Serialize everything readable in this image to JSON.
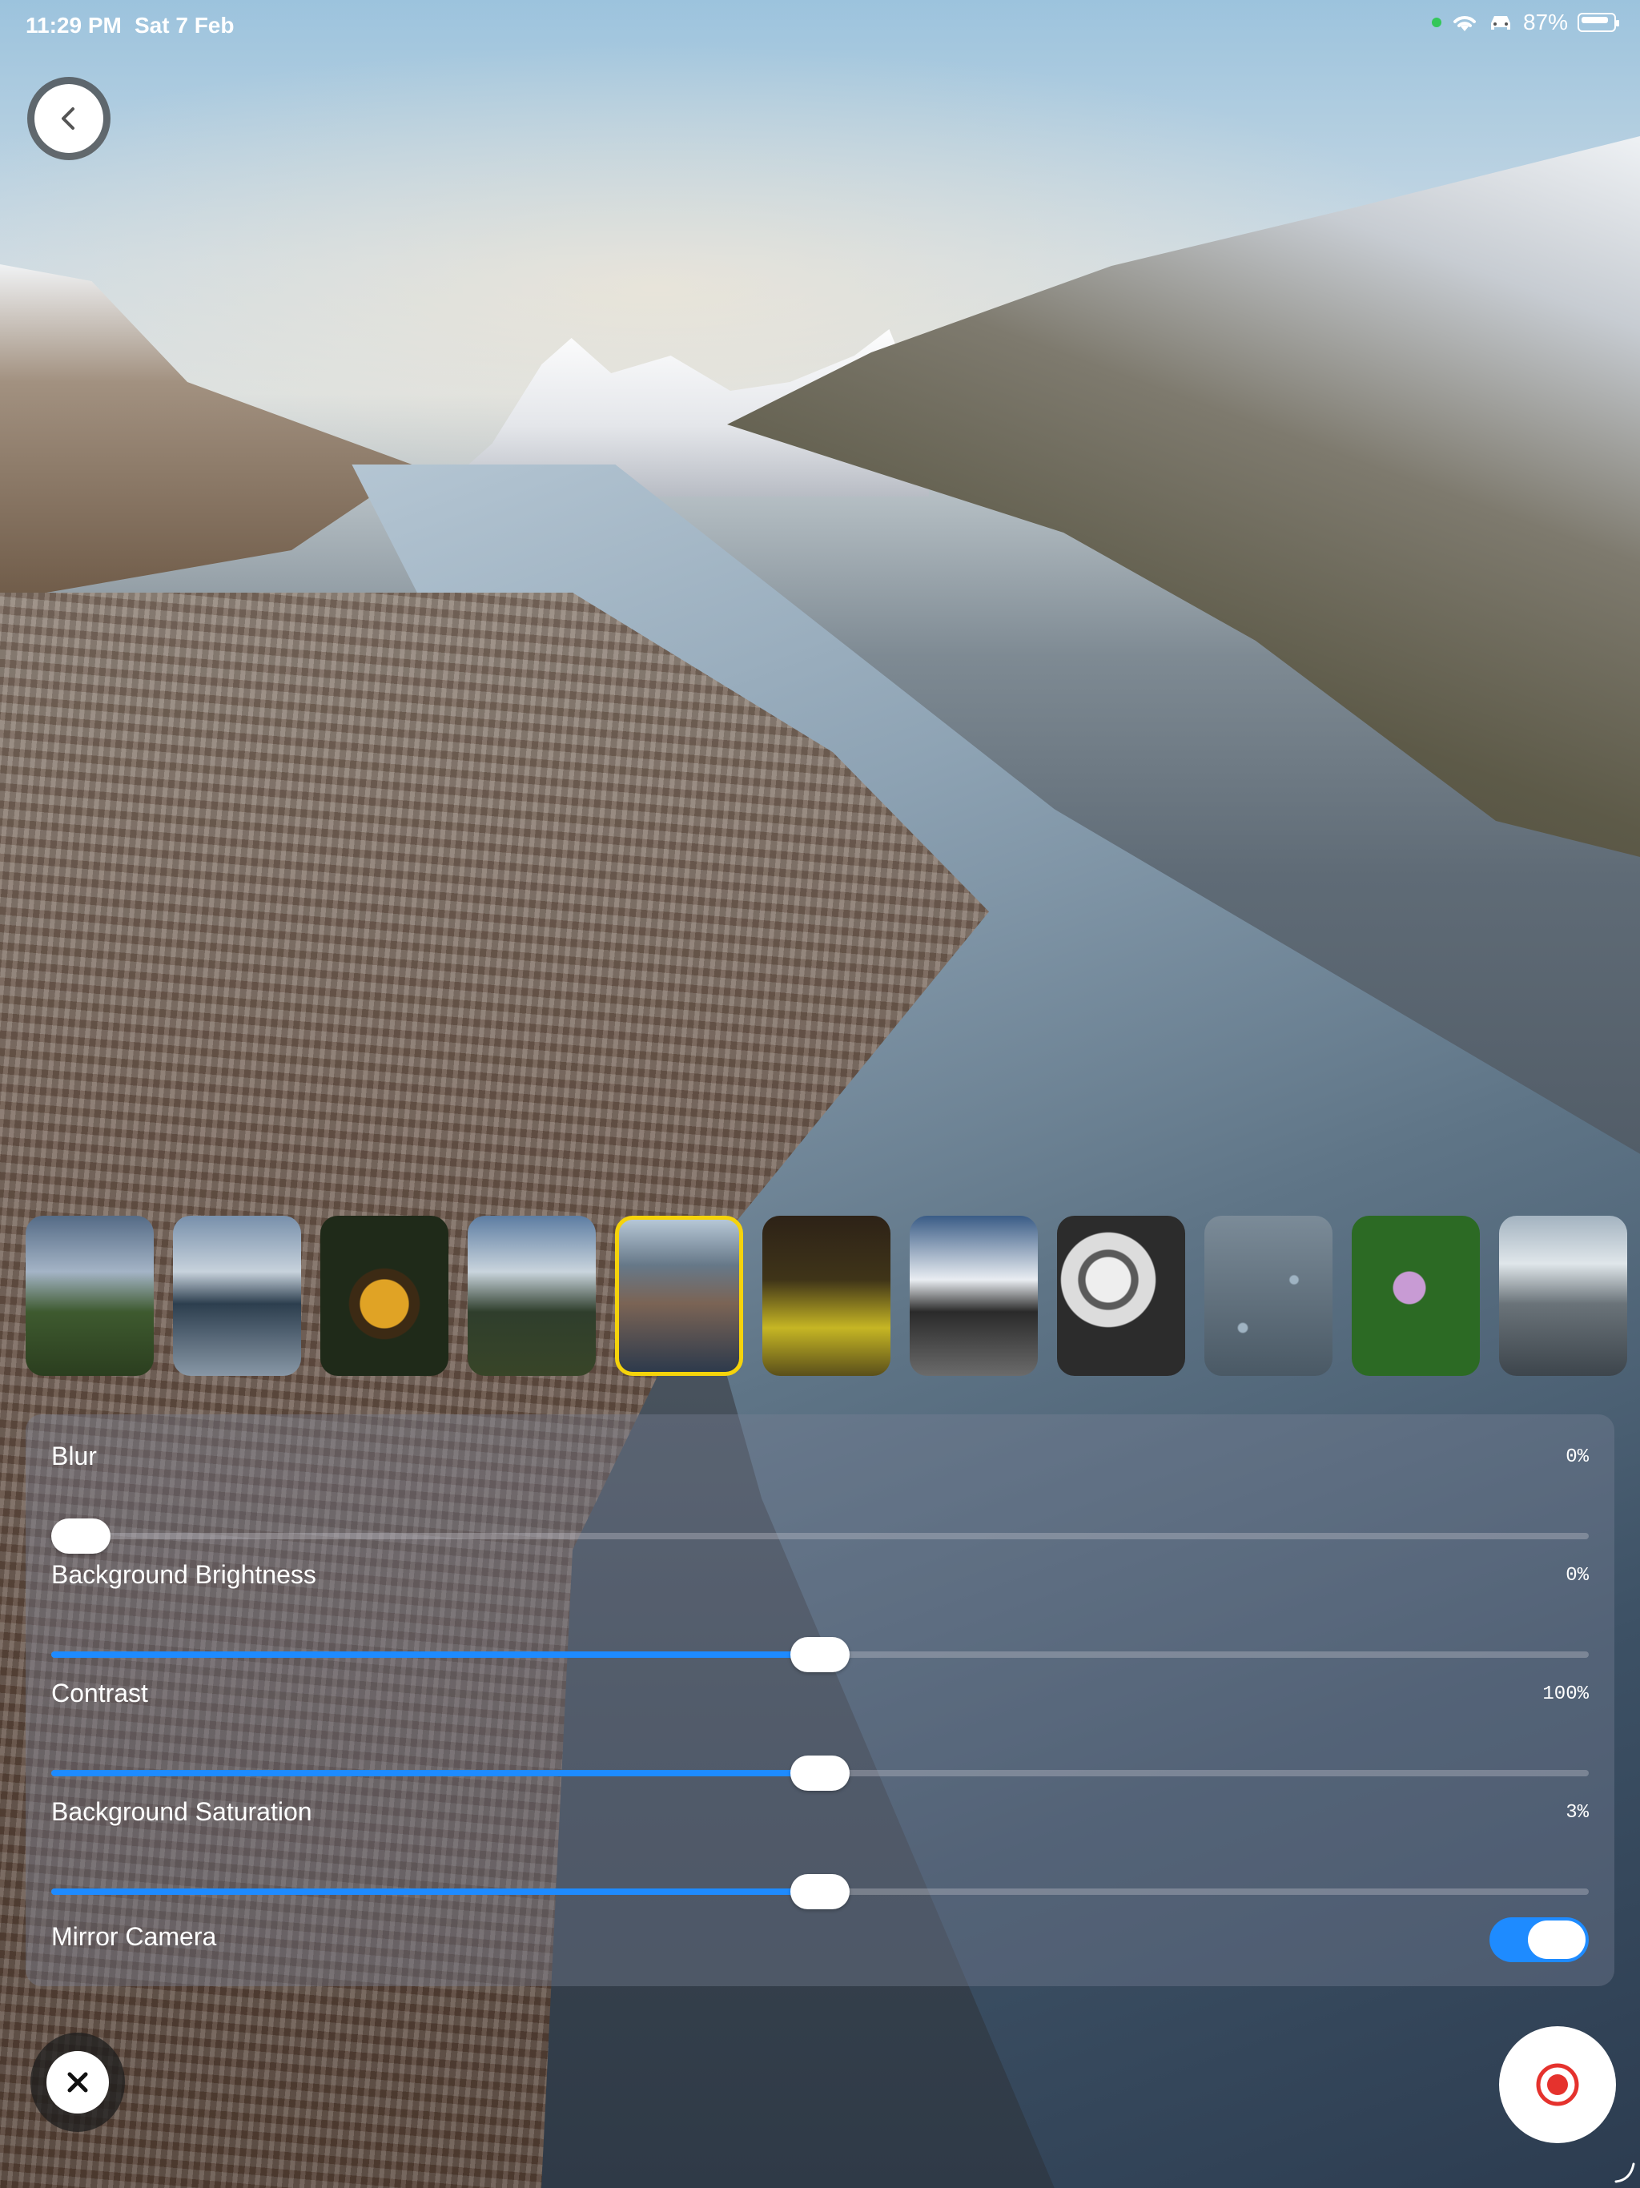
{
  "status_bar": {
    "time": "11:29 PM",
    "date": "Sat 7 Feb",
    "battery": "87%",
    "battery_level": 0.87
  },
  "back_button": {
    "icon": "chevron-left-icon"
  },
  "backgrounds": {
    "selected_index": 4,
    "thumbnails": [
      "mountain-valley",
      "lake-clouds",
      "autumn-leaves",
      "misty-mountains",
      "fjord-town",
      "forest-moss",
      "snowy-waterfall",
      "black-white-flowers",
      "raindrops-glass",
      "purple-daisies",
      "snowy-lake"
    ]
  },
  "settings": {
    "blur": {
      "label": "Blur",
      "value": "0%",
      "level": 0.0
    },
    "brightness": {
      "label": "Background Brightness",
      "value": "0%",
      "level": 0.5
    },
    "contrast": {
      "label": "Contrast",
      "value": "100%",
      "level": 0.5
    },
    "saturation": {
      "label": "Background Saturation",
      "value": "3%",
      "level": 0.5
    },
    "mirror": {
      "label": "Mirror Camera",
      "on": true
    }
  },
  "controls": {
    "close_icon": "close-icon",
    "record_icon": "record-icon"
  },
  "colors": {
    "accent": "#1e8bff",
    "selected_border": "#f5d30b",
    "record": "#e5322d"
  }
}
